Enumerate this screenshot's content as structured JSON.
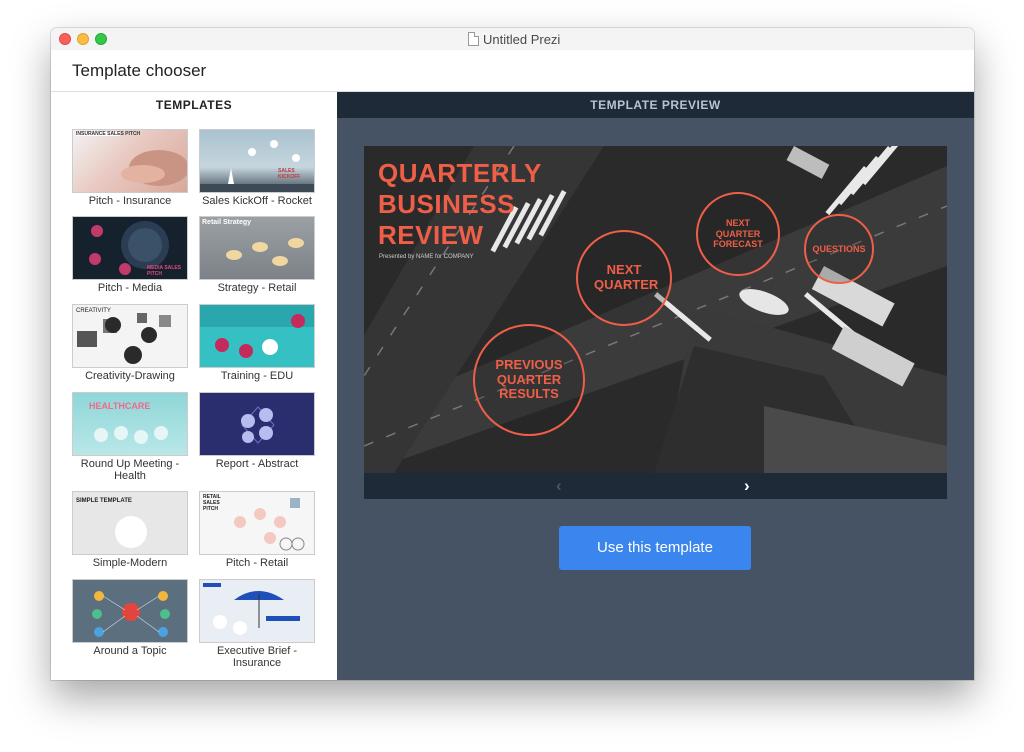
{
  "window": {
    "title": "Untitled Prezi",
    "chooser_title": "Template chooser"
  },
  "left_panel": {
    "heading": "TEMPLATES",
    "templates": [
      {
        "label": "Pitch - Insurance",
        "thumb_text": "INSURANCE SALES PITCH"
      },
      {
        "label": "Sales KickOff - Rocket",
        "thumb_text": "SALES KICKOFF"
      },
      {
        "label": "Pitch - Media",
        "thumb_text": "MEDIA SALES PITCH"
      },
      {
        "label": "Strategy - Retail",
        "thumb_text": "Retail Strategy"
      },
      {
        "label": "Creativity-Drawing",
        "thumb_text": "CREATIVITY"
      },
      {
        "label": "Training - EDU",
        "thumb_text": ""
      },
      {
        "label": "Round Up Meeting - Health",
        "thumb_text": "HEALTHCARE"
      },
      {
        "label": "Report - Abstract",
        "thumb_text": ""
      },
      {
        "label": "Simple-Modern",
        "thumb_text": "SIMPLE TEMPLATE"
      },
      {
        "label": "Pitch - Retail",
        "thumb_text": "RETAIL SALES PITCH"
      },
      {
        "label": "Around a Topic",
        "thumb_text": ""
      },
      {
        "label": "Executive Brief - Insurance",
        "thumb_text": ""
      }
    ]
  },
  "right_panel": {
    "heading": "TEMPLATE PREVIEW",
    "preview": {
      "title": "QUARTERLY BUSINESS REVIEW",
      "subtitle": "Presented by NAME for COMPANY",
      "circles": {
        "previous": "PREVIOUS QUARTER RESULTS",
        "next": "NEXT QUARTER",
        "forecast": "NEXT QUARTER FORECAST",
        "questions": "QUESTIONS"
      },
      "nav_prev": "‹",
      "nav_next": "›"
    },
    "use_button": "Use this template"
  },
  "colors": {
    "accent": "#3a86ee",
    "preview_bg": "#455365",
    "header_dark": "#1f2a38",
    "title_red": "#ef5f48"
  }
}
